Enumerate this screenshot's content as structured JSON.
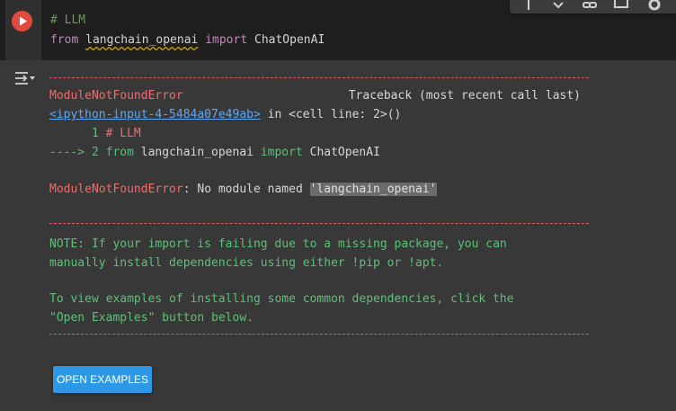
{
  "code_cell": {
    "line1_comment": "# LLM",
    "line2_from": "from",
    "line2_module": "langchain_openai",
    "line2_import": "import",
    "line2_name": "ChatOpenAI",
    "run_icon": "play-icon"
  },
  "toolbar": {
    "icons": [
      "arrow-up-icon",
      "arrow-down-icon",
      "link-icon",
      "comment-icon",
      "gear-icon"
    ]
  },
  "output": {
    "toggle_icon": "output-toggle-icon",
    "error_name": "ModuleNotFoundError",
    "traceback_label": "Traceback (most recent call last)",
    "input_link": "<ipython-input-4-5484a07e49ab>",
    "in_text": " in ",
    "cell_line": "<cell line: 2>()",
    "tb_line1_num": "      1",
    "tb_line1_code": " # LLM",
    "tb_line2_arrow": "----> 2",
    "tb_line2_from": " from",
    "tb_line2_module": " langchain_openai ",
    "tb_line2_import": "import",
    "tb_line2_name": " ChatOpenAI",
    "error_type": "ModuleNotFoundError",
    "error_message": ": No module named ",
    "error_module": "'langchain_openai'",
    "note_line1": "NOTE: If your import is failing due to a missing package, you can",
    "note_line2": "manually install dependencies using either !pip or !apt.",
    "note_line3": "To view examples of installing some common dependencies, click the",
    "note_line4": "\"Open Examples\" button below.",
    "open_examples_label": "OPEN EXAMPLES"
  },
  "colors": {
    "background": "#383838",
    "code_background": "#1e1e1e",
    "run_button": "#e24a3f",
    "error_red": "#f26b6b",
    "note_green": "#5fbf7a",
    "link_blue": "#5da8f5",
    "button_blue": "#2e97e6"
  }
}
